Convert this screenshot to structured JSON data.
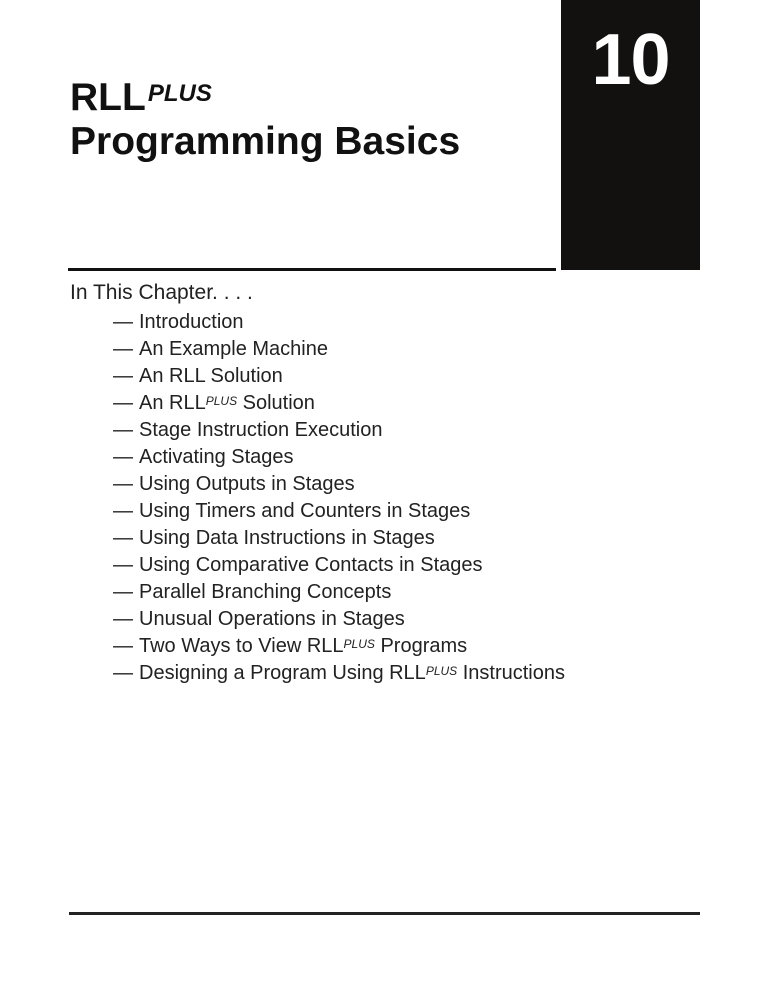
{
  "title": {
    "line1_main": "RLL",
    "line1_sup": "PLUS",
    "line2": "Programming Basics"
  },
  "chapter_number": "10",
  "intro_heading": "In This Chapter. . . .",
  "dash": "—",
  "items": [
    {
      "pre": "Introduction",
      "sup": "",
      "post": ""
    },
    {
      "pre": "An Example Machine",
      "sup": "",
      "post": ""
    },
    {
      "pre": "An RLL Solution",
      "sup": "",
      "post": ""
    },
    {
      "pre": "An RLL",
      "sup": "PLUS",
      "post": " Solution"
    },
    {
      "pre": "Stage Instruction Execution",
      "sup": "",
      "post": ""
    },
    {
      "pre": "Activating Stages",
      "sup": "",
      "post": ""
    },
    {
      "pre": "Using Outputs in Stages",
      "sup": "",
      "post": ""
    },
    {
      "pre": "Using Timers and Counters in Stages",
      "sup": "",
      "post": ""
    },
    {
      "pre": "Using Data Instructions in Stages",
      "sup": "",
      "post": ""
    },
    {
      "pre": "Using Comparative Contacts in Stages",
      "sup": "",
      "post": ""
    },
    {
      "pre": "Parallel Branching Concepts",
      "sup": "",
      "post": ""
    },
    {
      "pre": "Unusual Operations in Stages",
      "sup": "",
      "post": ""
    },
    {
      "pre": "Two Ways to View RLL",
      "sup": "PLUS",
      "post": " Programs"
    },
    {
      "pre": "Designing a Program Using RLL",
      "sup": "PLUS",
      "post": " Instructions"
    }
  ]
}
